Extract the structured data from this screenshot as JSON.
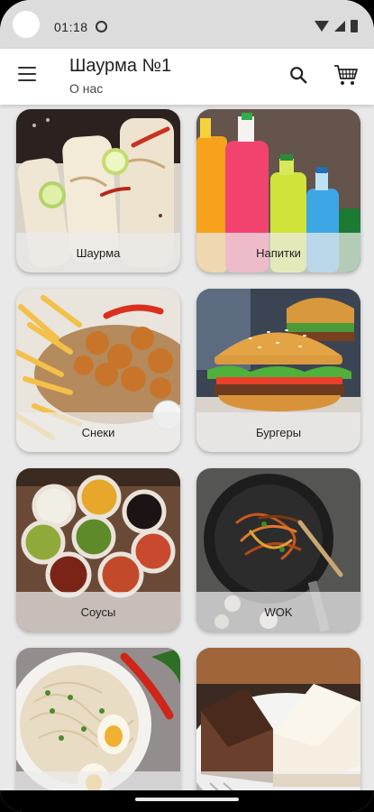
{
  "status": {
    "time": "01:18"
  },
  "header": {
    "title": "Шаурма №1",
    "subtitle": "О нас"
  },
  "icons": {
    "menu": "menu-icon",
    "search": "search-icon",
    "cart": "cart-icon"
  },
  "categories": [
    {
      "label": "Шаурма",
      "image": "shawarma-wraps"
    },
    {
      "label": "Напитки",
      "image": "bottled-drinks"
    },
    {
      "label": "Снеки",
      "image": "fries-and-nuggets"
    },
    {
      "label": "Бургеры",
      "image": "burger"
    },
    {
      "label": "Соусы",
      "image": "sauce-cups"
    },
    {
      "label": "WOK",
      "image": "wok-noodles"
    },
    {
      "label": "",
      "image": "ramen-bowl"
    },
    {
      "label": "",
      "image": "cheesecake"
    }
  ]
}
